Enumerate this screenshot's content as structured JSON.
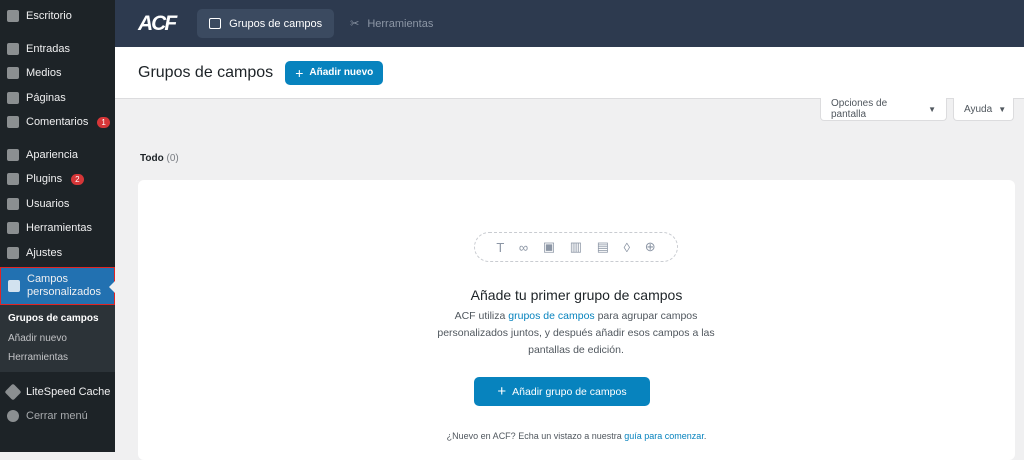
{
  "sidebar": {
    "items": [
      {
        "label": "Escritorio",
        "icon": "dashboard-icon"
      },
      {
        "label": "Entradas",
        "icon": "pin-icon"
      },
      {
        "label": "Medios",
        "icon": "media-icon"
      },
      {
        "label": "Páginas",
        "icon": "pages-icon"
      },
      {
        "label": "Comentarios",
        "icon": "comment-icon",
        "badge": "1"
      },
      {
        "label": "Apariencia",
        "icon": "brush-icon"
      },
      {
        "label": "Plugins",
        "icon": "plugin-icon",
        "badge": "2"
      },
      {
        "label": "Usuarios",
        "icon": "user-icon"
      },
      {
        "label": "Herramientas",
        "icon": "wrench-icon"
      },
      {
        "label": "Ajustes",
        "icon": "settings-icon"
      }
    ],
    "active": "Campos personalizados",
    "submenu": [
      "Grupos de campos",
      "Añadir nuevo",
      "Herramientas"
    ],
    "litespeed": "LiteSpeed Cache",
    "collapse": "Cerrar menú"
  },
  "topbar": {
    "logo": "ACF",
    "tabs": [
      "Grupos de campos",
      "Herramientas"
    ]
  },
  "header": {
    "title": "Grupos de campos",
    "add_new": "Añadir nuevo"
  },
  "screen_options": "Opciones de pantalla",
  "help": "Ayuda",
  "filter": {
    "label": "Todo",
    "count": "(0)"
  },
  "empty": {
    "title": "Añade tu primer grupo de campos",
    "desc_before": "ACF utiliza ",
    "desc_link": "grupos de campos",
    "desc_after": " para agrupar campos personalizados juntos, y después añadir esos campos a las pantallas de edición.",
    "button": "Añadir grupo de campos",
    "foot_before": "¿Nuevo en ACF? Echa un vistazo a nuestra ",
    "foot_link": "guía para comenzar",
    "foot_after": "."
  },
  "colors": {
    "accent": "#0783be",
    "sidebar": "#1d2327",
    "topbar": "#2d3a4f"
  }
}
